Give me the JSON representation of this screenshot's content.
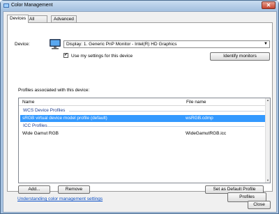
{
  "window": {
    "title": "Color Management"
  },
  "tabs": [
    {
      "label": "Devices"
    },
    {
      "label": "All Profiles"
    },
    {
      "label": "Advanced"
    }
  ],
  "device": {
    "label": "Device:",
    "selected": "Display: 1. Generic PnP Monitor - Intel(R) HD Graphics",
    "use_settings_label": "Use my settings for this device",
    "use_settings_checked": true,
    "identify_button": "Identify monitors"
  },
  "profiles": {
    "section_label": "Profiles associated with this device:",
    "columns": [
      "Name",
      "File name"
    ],
    "groups": [
      {
        "title": "WCS Device Profiles",
        "rows": [
          {
            "name": "sRGB virtual device model profile (default)",
            "file": "wsRGB.cdmp",
            "selected": true
          }
        ]
      },
      {
        "title": "ICC Profiles",
        "rows": [
          {
            "name": "Wide Gamut RGB",
            "file": "WideGamutRGB.icc",
            "selected": false
          }
        ]
      }
    ]
  },
  "buttons": {
    "add": "Add...",
    "remove": "Remove",
    "set_default": "Set as Default Profile",
    "profiles": "Profiles",
    "close": "Close"
  },
  "link": "Understanding color management settings",
  "colors": {
    "selection": "#3399ff",
    "link": "#0b4fc6",
    "group_header": "#1e3c8c"
  }
}
